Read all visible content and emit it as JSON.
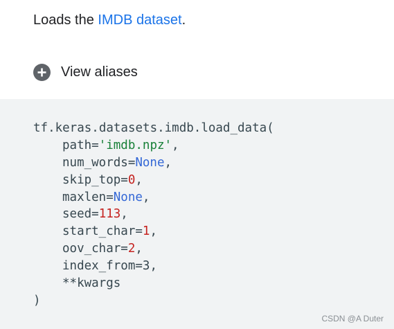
{
  "intro": {
    "prefix": "Loads the ",
    "link_text": "IMDB dataset",
    "suffix": "."
  },
  "aliases": {
    "icon": "plus-circle-icon",
    "label": "View aliases"
  },
  "code": {
    "func": "tf.keras.datasets.imdb.load_data(",
    "params": [
      {
        "name": "path=",
        "value": "'imdb.npz'",
        "kind": "str",
        "tail": ","
      },
      {
        "name": "num_words=",
        "value": "None",
        "kind": "kw",
        "tail": ","
      },
      {
        "name": "skip_top=",
        "value": "0",
        "kind": "num",
        "tail": ","
      },
      {
        "name": "maxlen=",
        "value": "None",
        "kind": "kw",
        "tail": ","
      },
      {
        "name": "seed=",
        "value": "113",
        "kind": "num",
        "tail": ","
      },
      {
        "name": "start_char=",
        "value": "1",
        "kind": "num",
        "tail": ","
      },
      {
        "name": "oov_char=",
        "value": "2",
        "kind": "num",
        "tail": ","
      },
      {
        "name": "index_from=",
        "value": "3",
        "kind": "plain",
        "tail": ","
      },
      {
        "name": "**kwargs",
        "value": "",
        "kind": "plain",
        "tail": ""
      }
    ],
    "close": ")"
  },
  "watermark": "CSDN @A Duter",
  "colors": {
    "link": "#1a73e8",
    "string": "#188038",
    "keyword": "#3367d6",
    "number": "#c5221f",
    "code_bg": "#f1f3f4"
  }
}
